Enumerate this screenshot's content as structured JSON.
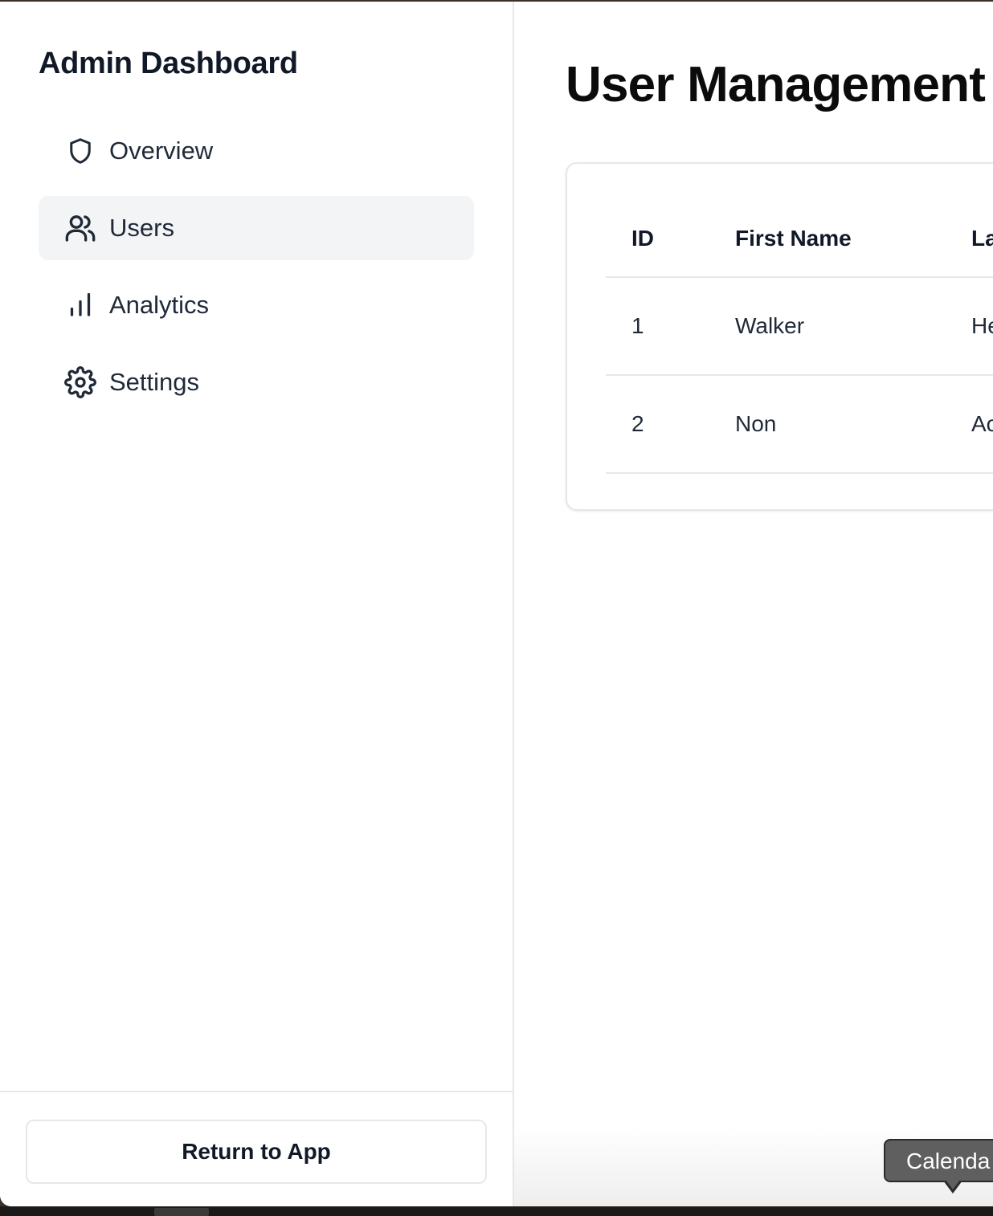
{
  "sidebar": {
    "brand": "Admin Dashboard",
    "items": [
      {
        "label": "Overview",
        "icon": "shield-icon",
        "active": false
      },
      {
        "label": "Users",
        "icon": "users-icon",
        "active": true
      },
      {
        "label": "Analytics",
        "icon": "bar-chart-icon",
        "active": false
      },
      {
        "label": "Settings",
        "icon": "gear-icon",
        "active": false
      }
    ],
    "return_label": "Return to App"
  },
  "main": {
    "title": "User Management",
    "table": {
      "headers": [
        "ID",
        "First Name",
        "La"
      ],
      "rows": [
        [
          "1",
          "Walker",
          "He"
        ],
        [
          "2",
          "Non",
          "Ac"
        ]
      ]
    }
  },
  "tooltip": {
    "text": "Calenda"
  },
  "colors": {
    "active_bg": "#f3f4f6",
    "text_primary": "#111827",
    "border": "#e5e7eb",
    "tooltip_bg": "#5f5f5f"
  }
}
